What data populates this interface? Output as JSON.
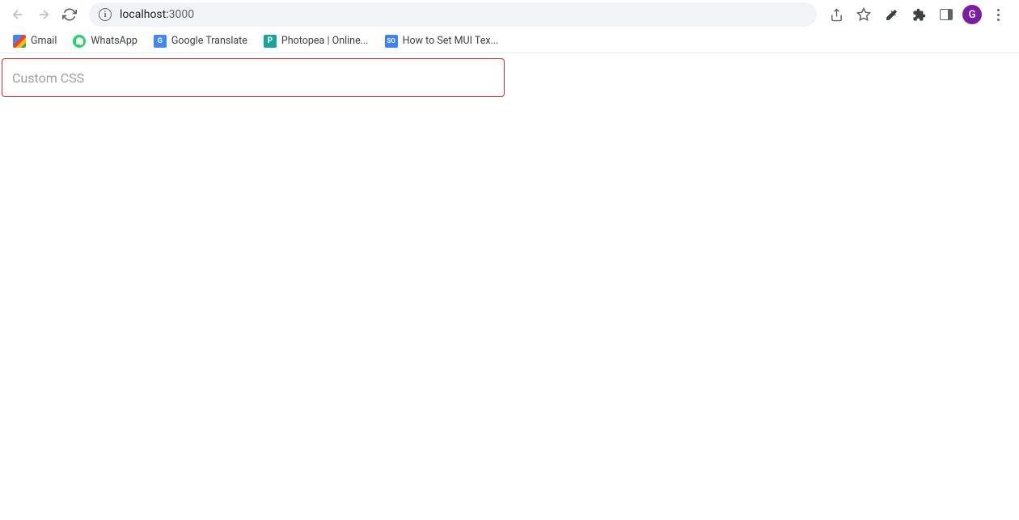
{
  "browser": {
    "url_host": "localhost:",
    "url_port": "3000",
    "avatar_letter": "G"
  },
  "bookmarks": [
    {
      "label": "Gmail"
    },
    {
      "label": "WhatsApp"
    },
    {
      "label": "Google Translate"
    },
    {
      "label": "Photopea | Online..."
    },
    {
      "label": "How to Set MUI Tex..."
    }
  ],
  "page": {
    "input_placeholder": "Custom CSS"
  }
}
